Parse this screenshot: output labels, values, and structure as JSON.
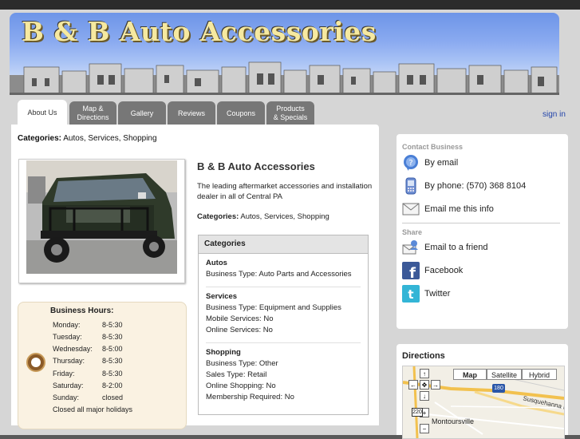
{
  "banner": {
    "title": "B & B Auto Accessories"
  },
  "tabs": [
    {
      "label": "About Us"
    },
    {
      "label": "Map &\nDirections"
    },
    {
      "label": "Gallery"
    },
    {
      "label": "Reviews"
    },
    {
      "label": "Coupons"
    },
    {
      "label": "Products\n& Specials"
    }
  ],
  "signin": "sign in",
  "main": {
    "categories_label": "Categories:",
    "categories_value": "Autos, Services, Shopping",
    "business_name": "B & B Auto Accessories",
    "description": "The leading aftermarket accessories and installation dealer in all of Central PA",
    "photo_icon": "truck-photo"
  },
  "catbox": {
    "title": "Categories",
    "sections": [
      {
        "title": "Autos",
        "lines": [
          "Business Type: Auto Parts and Accessories"
        ]
      },
      {
        "title": "Services",
        "lines": [
          "Business Type: Equipment and Supplies",
          "Mobile Services: No",
          "Online Services: No"
        ]
      },
      {
        "title": "Shopping",
        "lines": [
          "Business Type: Other",
          "Sales Type: Retail",
          "Online Shopping: No",
          "Membership Required: No"
        ]
      }
    ]
  },
  "hours": {
    "title": "Business Hours:",
    "rows": [
      {
        "day": "Monday:",
        "time": "8-5:30"
      },
      {
        "day": "Tuesday:",
        "time": "8-5:30"
      },
      {
        "day": "Wednesday:",
        "time": "8-5:00"
      },
      {
        "day": "Thursday:",
        "time": "8-5:30"
      },
      {
        "day": "Friday:",
        "time": "8-5:30"
      },
      {
        "day": "Saturday:",
        "time": "8-2:00"
      },
      {
        "day": "Sunday:",
        "time": "closed"
      }
    ],
    "note": "Closed all major holidays"
  },
  "contact": {
    "label": "Contact Business",
    "email": "By email",
    "phone": "By phone: (570) 368 8104",
    "emailme": "Email me this info"
  },
  "share": {
    "label": "Share",
    "friend": "Email to a friend",
    "facebook": "Facebook",
    "twitter": "Twitter"
  },
  "directions": {
    "title": "Directions",
    "map_btn": "Map",
    "satellite_btn": "Satellite",
    "hybrid_btn": "Hybrid",
    "town": "Montoursville",
    "road": "Susquehanna Bel",
    "route1": "180",
    "route2": "220"
  },
  "colors": {
    "tab": "#777777",
    "link": "#2244aa",
    "hours_bg": "#faf2e2"
  }
}
